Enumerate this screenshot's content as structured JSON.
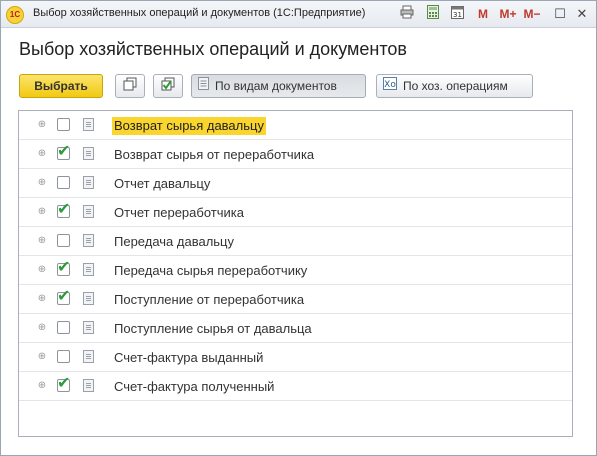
{
  "window": {
    "title": "Выбор хозяйственных операций и документов  (1С:Предприятие)",
    "logo_text": "1С",
    "toolbar_icons": [
      "print-icon",
      "calculator-icon",
      "calendar-icon"
    ],
    "m_buttons": [
      "M",
      "M+",
      "M−"
    ],
    "controls": {
      "minimize": "—",
      "maximize": "☐",
      "close": "✕"
    }
  },
  "page": {
    "heading": "Выбор хозяйственных операций и документов"
  },
  "toolbar": {
    "select_label": "Выбрать",
    "by_doc_types_label": "По видам документов",
    "by_operations_label": "По хоз. операциям"
  },
  "items": [
    {
      "label": "Возврат сырья давальцу",
      "checked": false,
      "selected": true
    },
    {
      "label": "Возврат сырья от переработчика",
      "checked": true,
      "selected": false
    },
    {
      "label": "Отчет давальцу",
      "checked": false,
      "selected": false
    },
    {
      "label": "Отчет переработчика",
      "checked": true,
      "selected": false
    },
    {
      "label": "Передача давальцу",
      "checked": false,
      "selected": false
    },
    {
      "label": "Передача сырья переработчику",
      "checked": true,
      "selected": false
    },
    {
      "label": "Поступление от переработчика",
      "checked": true,
      "selected": false
    },
    {
      "label": "Поступление сырья от давальца",
      "checked": false,
      "selected": false
    },
    {
      "label": "Счет-фактура выданный",
      "checked": false,
      "selected": false
    },
    {
      "label": "Счет-фактура полученный",
      "checked": true,
      "selected": false
    }
  ],
  "colors": {
    "accent": "#f9d52e",
    "check": "#2e9b3c"
  }
}
